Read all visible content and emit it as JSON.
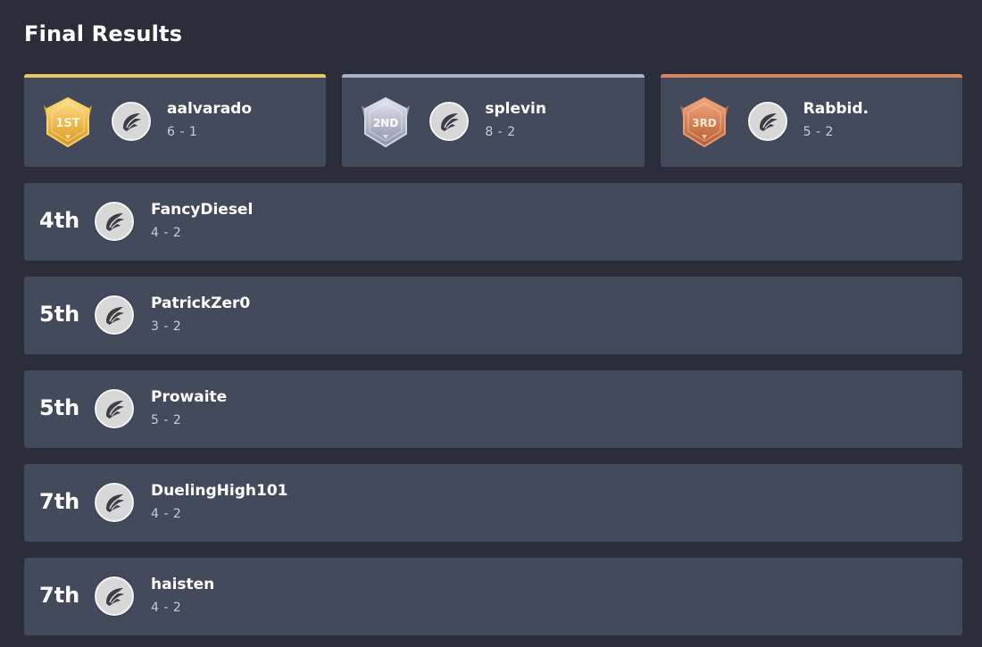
{
  "page": {
    "title": "Final Results"
  },
  "podium": [
    {
      "medal_text": "1ST",
      "name": "aalvarado",
      "record": "6 - 1",
      "accent": "#e9c766"
    },
    {
      "medal_text": "2ND",
      "name": "splevin",
      "record": "8 - 2",
      "accent": "#aab0c8"
    },
    {
      "medal_text": "3RD",
      "name": "Rabbid.",
      "record": "5 - 2",
      "accent": "#d5845b"
    }
  ],
  "rows": [
    {
      "rank": "4th",
      "name": "FancyDiesel",
      "record": "4 - 2"
    },
    {
      "rank": "5th",
      "name": "PatrickZer0",
      "record": "3 - 2"
    },
    {
      "rank": "5th",
      "name": "Prowaite",
      "record": "5 - 2"
    },
    {
      "rank": "7th",
      "name": "DuelingHigh101",
      "record": "4 - 2"
    },
    {
      "rank": "7th",
      "name": "haisten",
      "record": "4 - 2"
    }
  ],
  "icons": {
    "avatar": "wing-logo-icon",
    "medal": "medal-badge-icon"
  }
}
